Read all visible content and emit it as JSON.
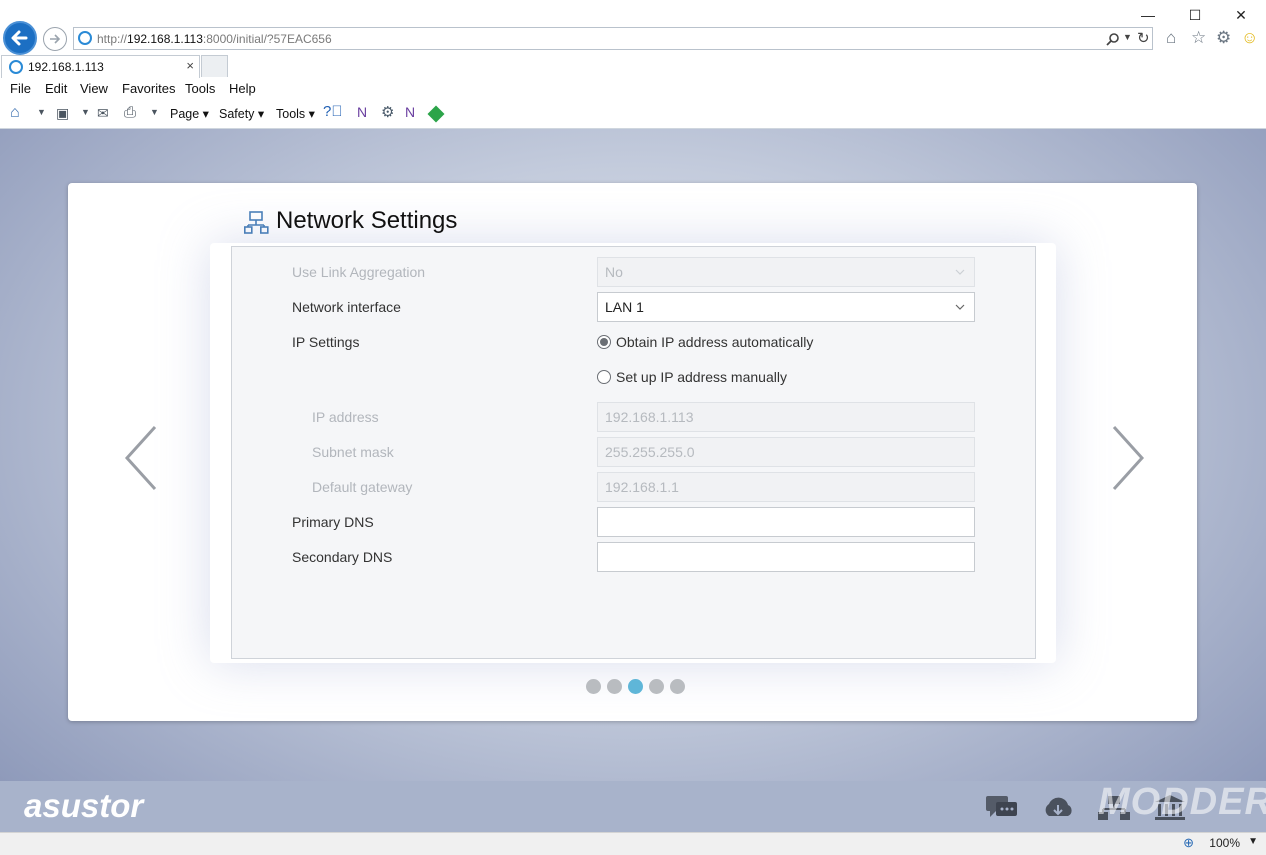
{
  "browser": {
    "url_prefix": "http://",
    "url_host": "192.168.1.113",
    "url_rest": ":8000/initial/?57EAC656",
    "tab_title": "192.168.1.113",
    "tab_close": "×",
    "menu": [
      "File",
      "Edit",
      "View",
      "Favorites",
      "Tools",
      "Help"
    ],
    "commands": {
      "page": "Page ▾",
      "safety": "Safety ▾",
      "tools": "Tools ▾"
    },
    "window_controls": {
      "minimize": "—",
      "maximize": "☐",
      "close": "✕"
    },
    "zoom": "100%"
  },
  "wizard": {
    "title": "Network Settings",
    "fields": {
      "link_aggregation": {
        "label": "Use Link Aggregation",
        "value": "No"
      },
      "network_interface": {
        "label": "Network interface",
        "value": "LAN 1"
      },
      "ip_settings": {
        "label": "IP Settings"
      },
      "radio_auto": {
        "label": "Obtain IP address automatically",
        "checked": true
      },
      "radio_manual": {
        "label": "Set up IP address manually",
        "checked": false
      },
      "ip_address": {
        "label": "IP address",
        "value": "192.168.1.113"
      },
      "subnet_mask": {
        "label": "Subnet mask",
        "value": "255.255.255.0"
      },
      "default_gateway": {
        "label": "Default gateway",
        "value": "192.168.1.1"
      },
      "primary_dns": {
        "label": "Primary DNS",
        "value": ""
      },
      "secondary_dns": {
        "label": "Secondary DNS",
        "value": ""
      }
    },
    "steps": {
      "total": 5,
      "current": 3
    }
  },
  "footer": {
    "brand": "asustor",
    "watermark": "MODDERS",
    "icons": [
      "chat-icon",
      "cloud-download-icon",
      "network-icon",
      "bank-icon"
    ]
  },
  "colors": {
    "accent": "#5fb6d8",
    "page_bg_edge": "#8894b6",
    "footer_bg": "#a8b3cb"
  }
}
